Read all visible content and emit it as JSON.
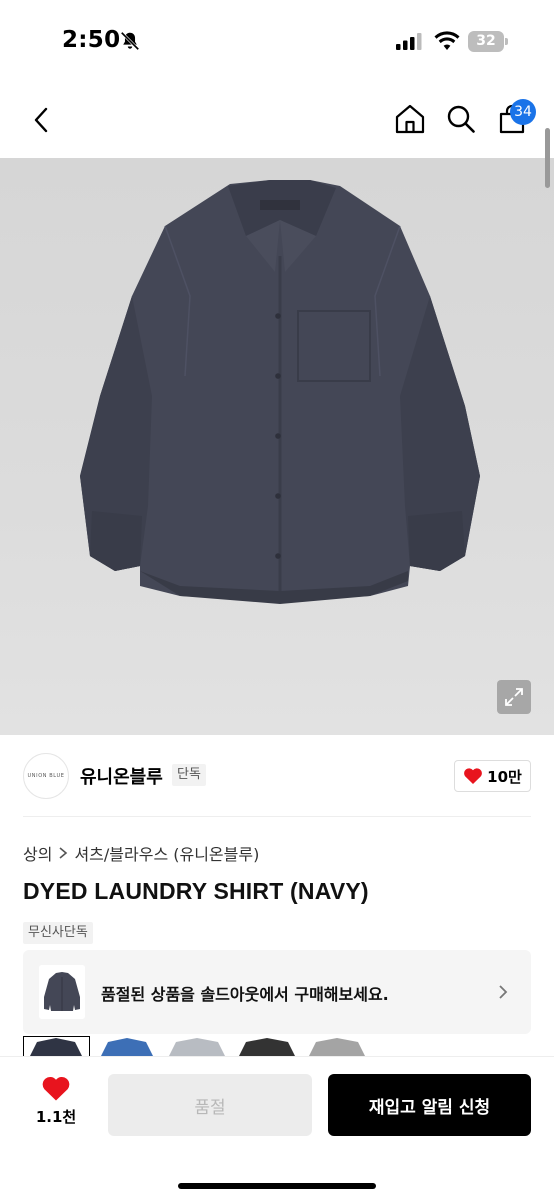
{
  "status_bar": {
    "time": "2:50",
    "battery": "32",
    "icons": [
      "bell-slash-icon",
      "cellular-signal-icon",
      "wifi-icon",
      "battery-icon"
    ]
  },
  "nav": {
    "icons": [
      "chevron-left-icon",
      "home-icon",
      "search-icon",
      "cart-icon"
    ],
    "cart_count": "34"
  },
  "product_image": {
    "icon": "expand-icon"
  },
  "brand": {
    "logo_text": "UNION BLUE",
    "name": "유니온블루",
    "tag": "단독",
    "like_count": "10만"
  },
  "breadcrumb": {
    "items": [
      "상의",
      "셔츠/블라우스 (유니온블루)"
    ]
  },
  "product": {
    "title": "DYED LAUNDRY SHIRT (NAVY)",
    "tag": "무신사단독"
  },
  "soldout_banner": {
    "text": "품절된 상품을 솔드아웃에서 구매해보세요."
  },
  "color_options": [
    {
      "color": "#2f3444"
    },
    {
      "color": "#3d6fb6"
    },
    {
      "color": "#b8bcc2"
    },
    {
      "color": "#333333"
    },
    {
      "color": "#a4a4a4"
    }
  ],
  "bottom_bar": {
    "wish_count": "1.1천",
    "soldout_label": "품절",
    "restock_label": "재입고 알림 신청"
  },
  "colors": {
    "accent_blue": "#1a73e8",
    "heart_red": "#e8141e",
    "shirt_navy": "#444756"
  }
}
